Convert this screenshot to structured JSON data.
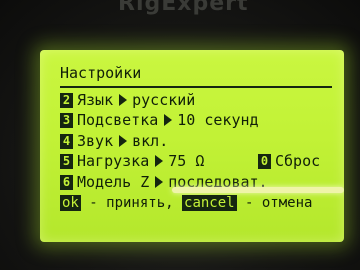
{
  "brand": "RigExpert",
  "menu": {
    "title": "Настройки",
    "items": [
      {
        "num": "2",
        "label": "Язык",
        "value": "русский"
      },
      {
        "num": "3",
        "label": "Подсветка",
        "value": "10 секунд"
      },
      {
        "num": "4",
        "label": "Звук",
        "value": "вкл."
      },
      {
        "num": "5",
        "label": "Нагрузка",
        "value": "75 Ω"
      },
      {
        "num": "6",
        "label": "Модель Z",
        "value": "последоват."
      }
    ],
    "reset": {
      "num": "0",
      "label": "Сброс"
    }
  },
  "footer": {
    "ok_key": "ok",
    "ok_text": " - принять, ",
    "cancel_key": "cancel",
    "cancel_text": " - отмена"
  },
  "colors": {
    "screen": "#c2f236",
    "text": "#112008",
    "bezel": "#151513"
  }
}
